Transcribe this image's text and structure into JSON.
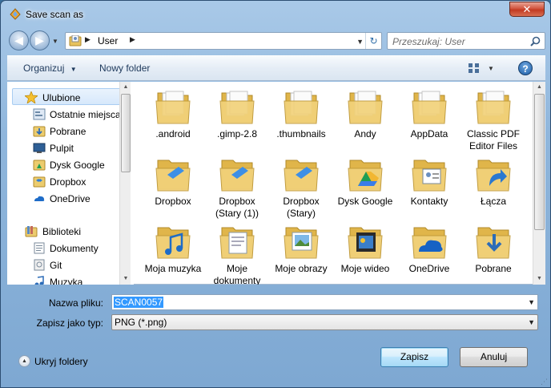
{
  "window": {
    "title": "Save scan as",
    "close_glyph": "✕"
  },
  "nav": {
    "back_glyph": "◀",
    "forward_glyph": "▶",
    "address_segments": [
      "User"
    ],
    "refresh_glyph": "↻",
    "search_placeholder": "Przeszukaj: User"
  },
  "toolbar": {
    "organize_label": "Organizuj",
    "organize_arrow": "▼",
    "new_folder_label": "Nowy folder",
    "help_glyph": "?"
  },
  "sidebar": {
    "favorites": {
      "label": "Ulubione",
      "items": [
        {
          "label": "Ostatnie miejsca",
          "icon": "recent-places-icon"
        },
        {
          "label": "Pobrane",
          "icon": "downloads-folder-icon"
        },
        {
          "label": "Pulpit",
          "icon": "desktop-icon"
        },
        {
          "label": "Dysk Google",
          "icon": "google-drive-folder-icon"
        },
        {
          "label": "Dropbox",
          "icon": "dropbox-icon"
        },
        {
          "label": "OneDrive",
          "icon": "onedrive-icon"
        }
      ]
    },
    "libraries": {
      "label": "Biblioteki",
      "items": [
        {
          "label": "Dokumenty",
          "icon": "documents-library-icon"
        },
        {
          "label": "Git",
          "icon": "git-library-icon"
        },
        {
          "label": "Muzyka",
          "icon": "music-library-icon"
        }
      ]
    }
  },
  "files": [
    {
      "name": ".android",
      "icon": "folder-icon"
    },
    {
      "name": ".gimp-2.8",
      "icon": "folder-icon"
    },
    {
      "name": ".thumbnails",
      "icon": "folder-icon"
    },
    {
      "name": "Andy",
      "icon": "folder-icon"
    },
    {
      "name": "AppData",
      "icon": "folder-icon"
    },
    {
      "name": "Classic PDF Editor Files",
      "icon": "folder-icon"
    },
    {
      "name": "Dropbox",
      "icon": "dropbox-folder-icon"
    },
    {
      "name": "Dropbox (Stary (1))",
      "icon": "dropbox-folder-icon"
    },
    {
      "name": "Dropbox (Stary)",
      "icon": "dropbox-folder-icon"
    },
    {
      "name": "Dysk Google",
      "icon": "google-drive-folder-icon"
    },
    {
      "name": "Kontakty",
      "icon": "contacts-folder-icon"
    },
    {
      "name": "Łącza",
      "icon": "links-folder-icon"
    },
    {
      "name": "Moja muzyka",
      "icon": "music-folder-icon"
    },
    {
      "name": "Moje dokumenty",
      "icon": "documents-folder-icon"
    },
    {
      "name": "Moje obrazy",
      "icon": "pictures-folder-icon"
    },
    {
      "name": "Moje wideo",
      "icon": "videos-folder-icon"
    },
    {
      "name": "OneDrive",
      "icon": "onedrive-folder-icon"
    },
    {
      "name": "Pobrane",
      "icon": "downloads-folder-icon"
    }
  ],
  "form": {
    "filename_label": "Nazwa pliku:",
    "filename_value": "SCAN0057",
    "filetype_label": "Zapisz jako typ:",
    "filetype_value": "PNG (*.png)",
    "dropdown_glyph": "▼"
  },
  "footer": {
    "hide_folders_label": "Ukryj foldery",
    "save_label": "Zapisz",
    "cancel_label": "Anuluj"
  },
  "colors": {
    "frame": "#8fb6dc",
    "selection": "#3399ff",
    "folder": "#f2d27a"
  }
}
